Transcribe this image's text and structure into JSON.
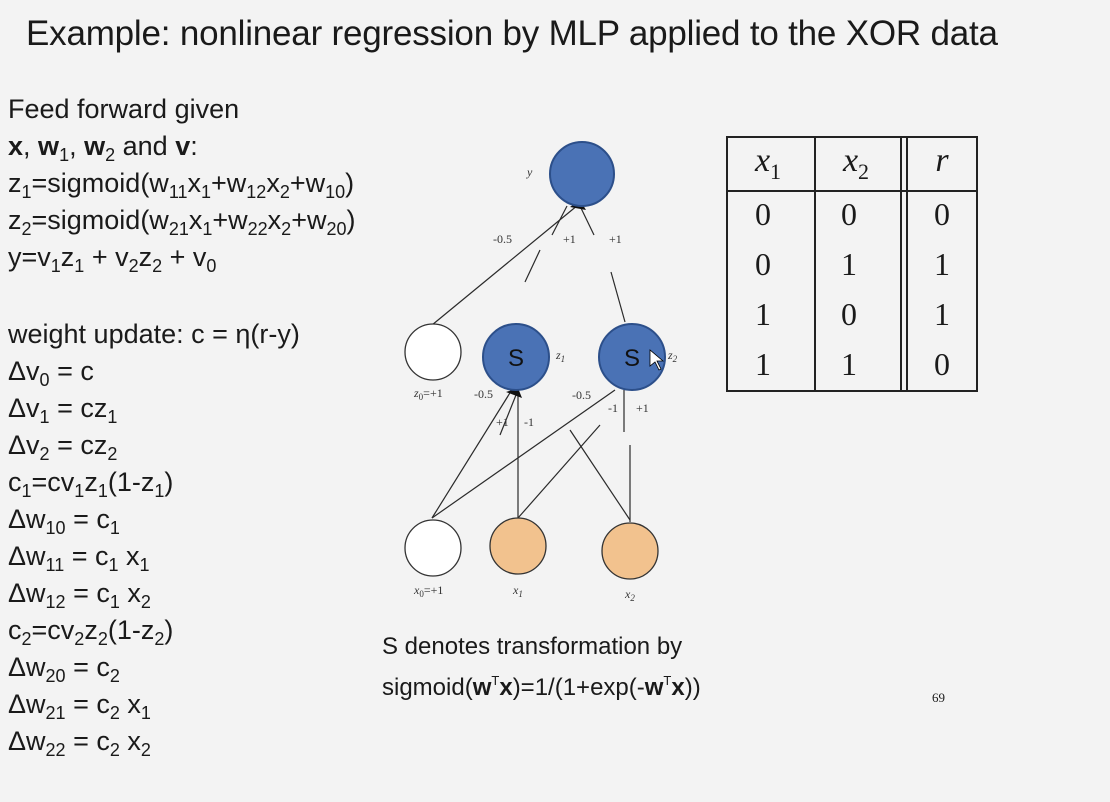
{
  "title": "Example: nonlinear regression by MLP applied to the XOR data",
  "left_text": {
    "intro_1": "Feed forward given",
    "intro_2": {
      "x": "x",
      "sep1": ", ",
      "w": "w",
      "w1_sub": "1",
      "sep2": ", ",
      "w2": "w",
      "w2_sub": "2",
      "and": " and ",
      "v": "v",
      "colon": ":"
    },
    "z1": {
      "a": "z",
      "a_sub": "1",
      "b": "=sigmoid(w",
      "b_sub": "11",
      "c": "x",
      "c_sub": "1",
      "d": "+w",
      "d_sub": "12",
      "e": "x",
      "e_sub": "2",
      "f": "+w",
      "f_sub": "10",
      "g": ")"
    },
    "z2": {
      "a": "z",
      "a_sub": "2",
      "b": "=sigmoid(w",
      "b_sub": "21",
      "c": "x",
      "c_sub": "1",
      "d": "+w",
      "d_sub": "22",
      "e": "x",
      "e_sub": "2",
      "f": "+w",
      "f_sub": "20",
      "g": ")"
    },
    "y_eq": {
      "a": "y=v",
      "a_sub": "1",
      "b": "z",
      "b_sub": "1",
      "c": " + v",
      "c_sub": "2",
      "d": "z",
      "d_sub": "2",
      "e": " + v",
      "e_sub": "0"
    },
    "update": "weight update: c = η(r-y)",
    "dv0": {
      "a": "Δv",
      "a_sub": "0",
      "b": " = c"
    },
    "dv1": {
      "a": "Δv",
      "a_sub": "1",
      "b": " = cz",
      "b_sub": "1"
    },
    "dv2": {
      "a": "Δv",
      "a_sub": "2",
      "b": " = cz",
      "b_sub": "2"
    },
    "c1": {
      "a": "c",
      "a_sub": "1",
      "b": "=cv",
      "b_sub": "1",
      "c": "z",
      "c_sub": "1",
      "d": "(1-z",
      "d_sub": "1",
      "e": ")"
    },
    "dw10": {
      "a": "Δw",
      "a_sub": "10",
      "b": " = c",
      "b_sub": "1"
    },
    "dw11": {
      "a": "Δw",
      "a_sub": "11",
      "b": " = c",
      "b_sub": "1",
      "c": " x",
      "c_sub": "1"
    },
    "dw12": {
      "a": "Δw",
      "a_sub": "12",
      "b": " = c",
      "b_sub": "1",
      "c": " x",
      "c_sub": "2"
    },
    "c2": {
      "a": "c",
      "a_sub": "2",
      "b": "=cv",
      "b_sub": "2",
      "c": "z",
      "c_sub": "2",
      "d": "(1-z",
      "d_sub": "2",
      "e": ")"
    },
    "dw20": {
      "a": "Δw",
      "a_sub": "20",
      "b": " = c",
      "b_sub": "2"
    },
    "dw21": {
      "a": "Δw",
      "a_sub": "21",
      "b": " = c",
      "b_sub": "2",
      "c": " x",
      "c_sub": "1"
    },
    "dw22": {
      "a": "Δw",
      "a_sub": "22",
      "b": " = c",
      "b_sub": "2",
      "c": " x",
      "c_sub": "2"
    }
  },
  "network": {
    "output_label": "y",
    "hidden_symbol": "S",
    "z1_label": "z",
    "z1_sub": "1",
    "z2_label": "z",
    "z2_sub": "2",
    "bias_hidden_label": "z",
    "bias_hidden_sub": "0",
    "bias_hidden_value": "=+1",
    "bias_input_label": "x",
    "bias_input_sub": "0",
    "bias_input_value": "=+1",
    "x1_label": "x",
    "x1_sub": "1",
    "x2_label": "x",
    "x2_sub": "2",
    "out_weights": [
      "-0.5",
      "+1",
      "+1"
    ],
    "h1_weights": [
      "-0.5",
      "+1",
      "-1"
    ],
    "h2_weights": [
      "-0.5",
      "-1",
      "+1"
    ],
    "colors": {
      "blue": "#4a72b5",
      "blue_stroke": "#2c4f8a",
      "orange": "#f2c28e",
      "orange_stroke": "#333333"
    }
  },
  "xor_table": {
    "headers": [
      {
        "sym": "x",
        "sub": "1"
      },
      {
        "sym": "x",
        "sub": "2"
      },
      {
        "sym": "r",
        "sub": ""
      }
    ],
    "rows": [
      [
        "0",
        "0",
        "0"
      ],
      [
        "0",
        "1",
        "1"
      ],
      [
        "1",
        "0",
        "1"
      ],
      [
        "1",
        "1",
        "0"
      ]
    ]
  },
  "caption": {
    "line1": "S denotes transformation by",
    "l2_a": "sigmoid(",
    "l2_w": "w",
    "l2_t": "T",
    "l2_x": "x",
    "l2_b": ")=1/(1+exp(-",
    "l2_w2": "w",
    "l2_t2": "T",
    "l2_x2": "x",
    "l2_c": "))"
  },
  "page_number": "69"
}
